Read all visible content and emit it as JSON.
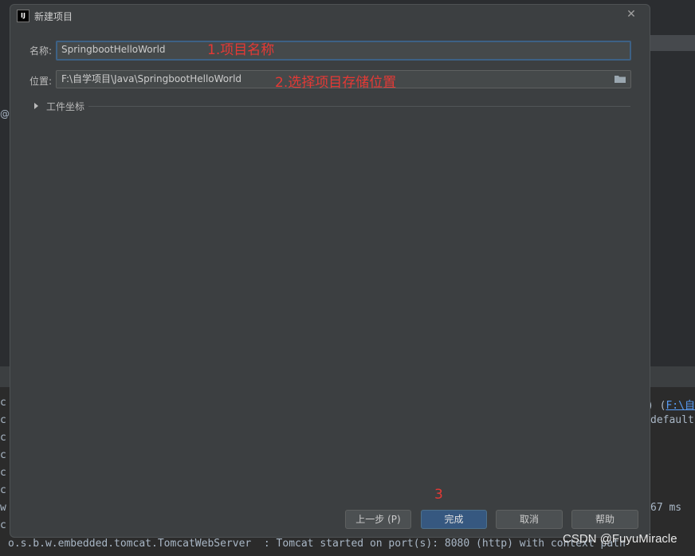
{
  "dialog": {
    "title": "新建项目",
    "name_label": "名称:",
    "name_value": "SpringbootHelloWorld",
    "location_label": "位置:",
    "location_value": "F:\\自学项目\\Java\\SpringbootHelloWorld",
    "section_label": "工件坐标",
    "buttons": {
      "previous": "上一步 (P)",
      "finish": "完成",
      "cancel": "取消",
      "help": "帮助"
    }
  },
  "annotations": {
    "name_note": "1.项目名称",
    "location_note": "2.选择项目存储位置",
    "step3": "3"
  },
  "background": {
    "at_symbol": "@",
    "console_right_1_prefix": ") (",
    "console_right_1_link": "F:\\自",
    "console_right_2": "default",
    "console_right_3": "67 ms",
    "console_left_chars": [
      "c",
      "c",
      "c",
      "c",
      "c",
      "c",
      "w",
      "c"
    ],
    "log_line": "o.s.b.w.embedded.tomcat.TomcatWebServer  : Tomcat started on port(s): 8080 (http) with context path"
  },
  "watermark": "CSDN @FuyuMiracle",
  "colors": {
    "accent": "#365880",
    "focus_border": "#3d6185",
    "annotation": "#e53935",
    "dialog_bg": "#3c3f41"
  },
  "icons": {
    "app": "intellij-icon",
    "close": "close-icon",
    "folder": "folder-icon",
    "expand": "triangle-right-icon"
  }
}
